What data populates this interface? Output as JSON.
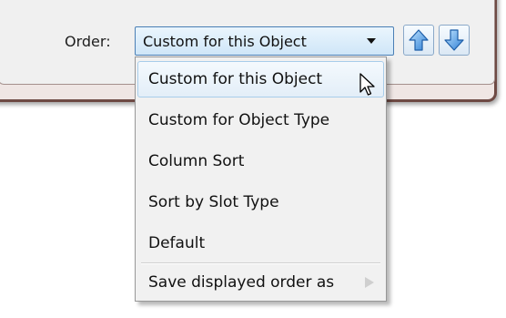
{
  "order_row": {
    "label": "Order:",
    "combo_value": "Custom for this Object",
    "move_up_icon": "arrow-up-icon",
    "move_down_icon": "arrow-down-icon"
  },
  "menu": {
    "items": [
      {
        "label": "Custom for this Object",
        "highlighted": true
      },
      {
        "label": "Custom for Object Type"
      },
      {
        "label": "Column Sort"
      },
      {
        "label": "Sort by Slot Type"
      },
      {
        "label": "Default"
      }
    ],
    "footer_item": {
      "label": "Save displayed order as",
      "submenu_icon": "submenu-arrow-icon"
    }
  },
  "colors": {
    "accent_blue": "#4a90d9",
    "highlight": "#e3eef8",
    "dialog_border": "#6e4a44"
  }
}
